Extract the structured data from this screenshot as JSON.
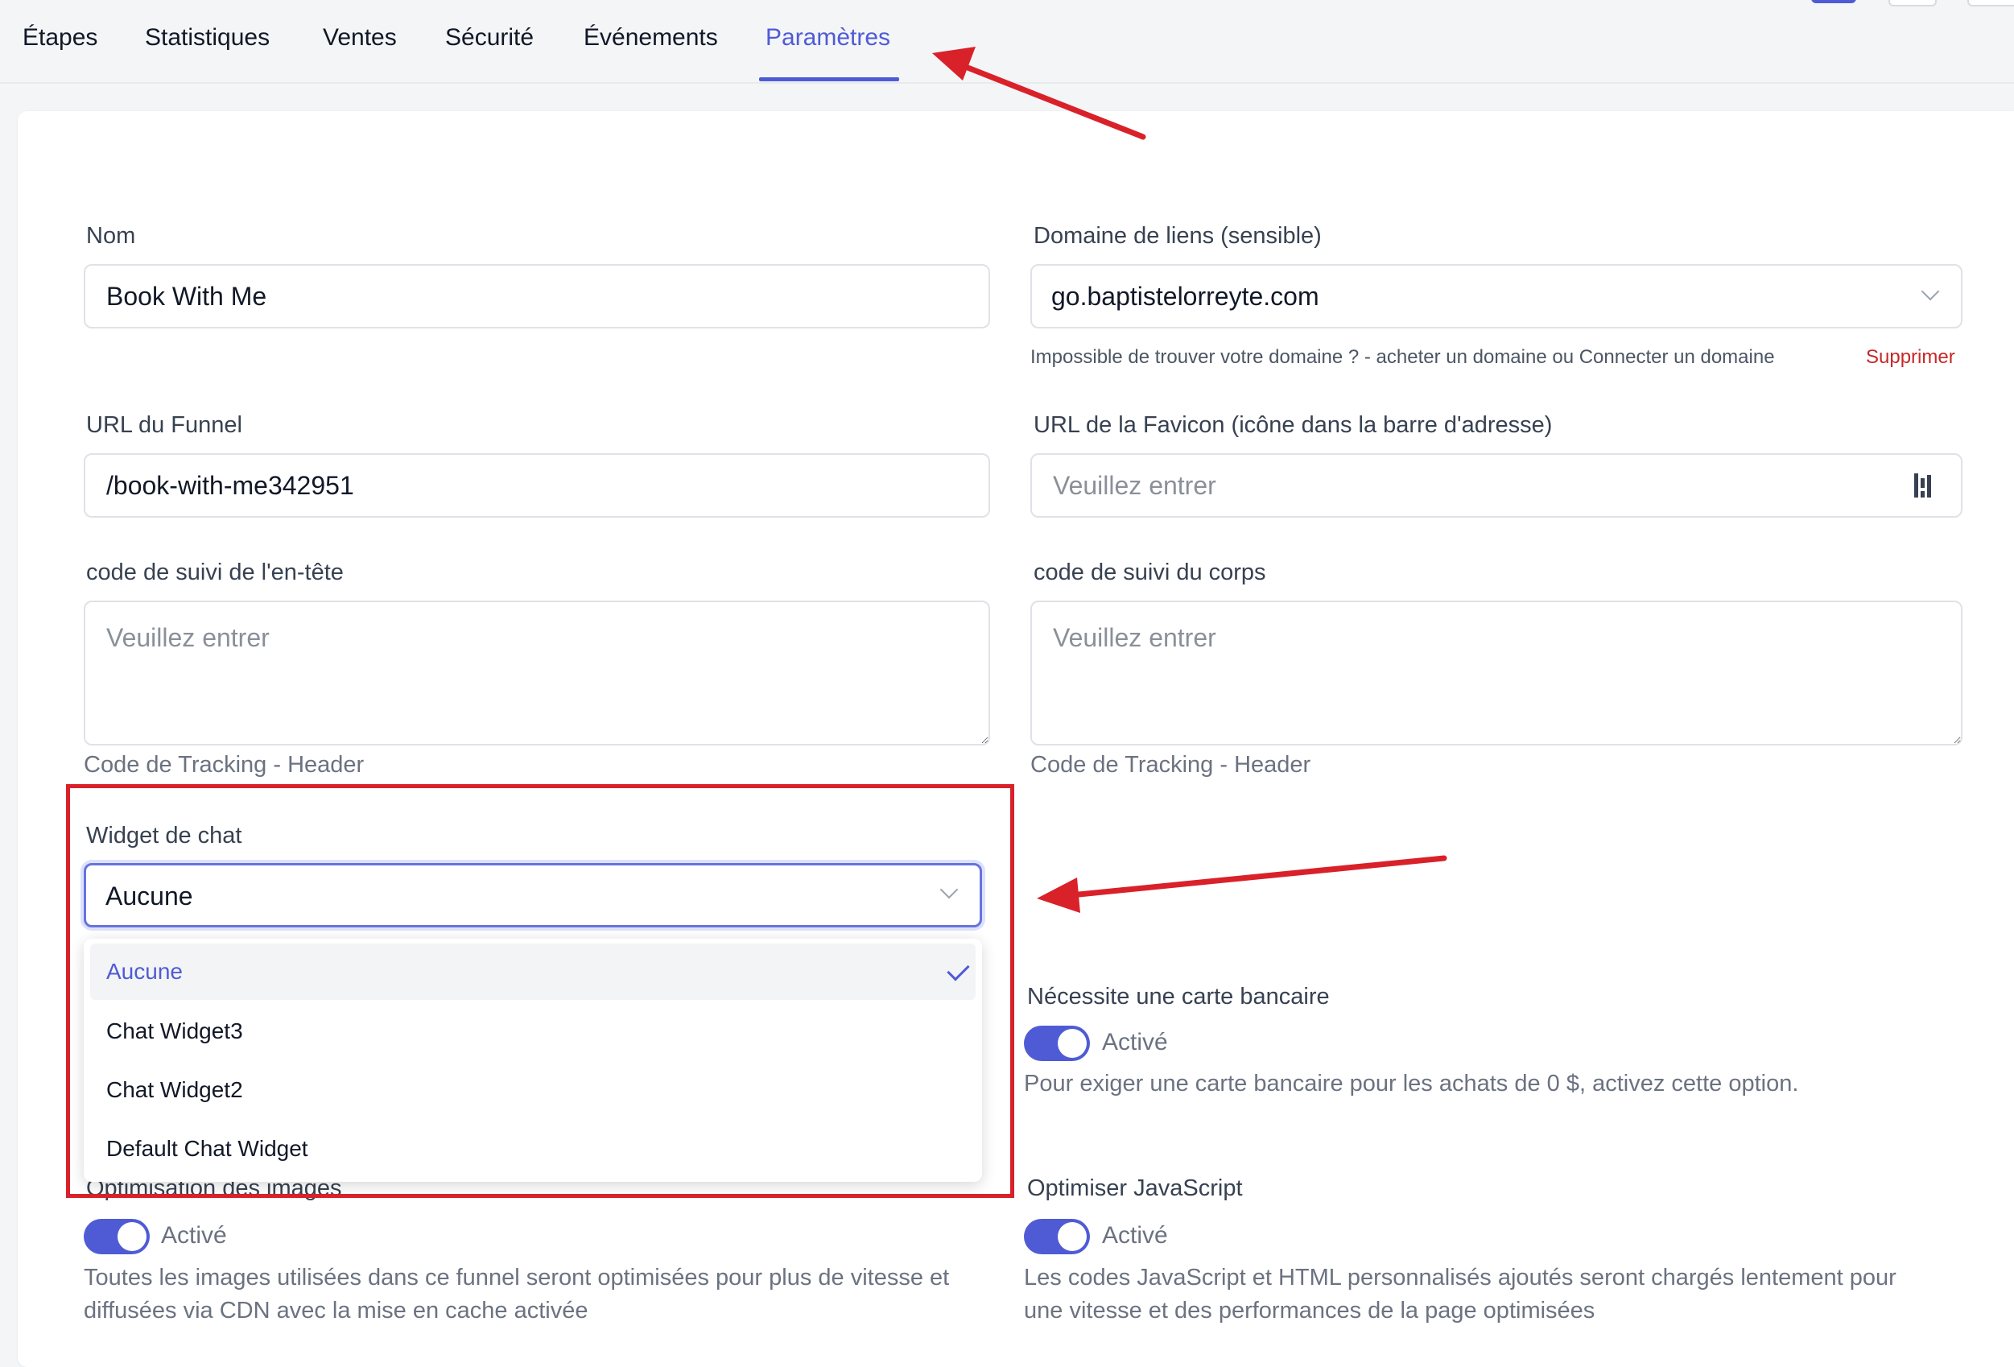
{
  "tabs": {
    "items": [
      {
        "label": "Étapes"
      },
      {
        "label": "Statistiques"
      },
      {
        "label": "Ventes"
      },
      {
        "label": "Sécurité"
      },
      {
        "label": "Événements"
      },
      {
        "label": "Paramètres"
      }
    ],
    "active_index": 5
  },
  "form": {
    "name": {
      "label": "Nom",
      "value": "Book With Me"
    },
    "domain": {
      "label": "Domaine de liens (sensible)",
      "value": "go.baptistelorreyte.com",
      "help_text": "Impossible de trouver votre domaine ? - acheter un domaine ou Connecter un domaine",
      "delete_link": "Supprimer"
    },
    "funnel_url": {
      "label": "URL du Funnel",
      "value": "/book-with-me342951"
    },
    "favicon_url": {
      "label": "URL de la Favicon (icône dans la barre d'adresse)",
      "placeholder": "Veuillez entrer"
    },
    "header_code": {
      "label": "code de suivi de l'en-tête",
      "placeholder": "Veuillez entrer",
      "hint": "Code de Tracking - Header"
    },
    "body_code": {
      "label": "code de suivi du corps",
      "placeholder": "Veuillez entrer",
      "hint": "Code de Tracking - Header"
    },
    "chat_widget": {
      "label": "Widget de chat",
      "value": "Aucune",
      "options": [
        "Aucune",
        "Chat Widget3",
        "Chat Widget2",
        "Default Chat Widget"
      ],
      "selected": "Aucune"
    },
    "credit_card": {
      "label": "Nécessite une carte bancaire",
      "toggle_text": "Activé",
      "enabled": true,
      "description": "Pour exiger une carte bancaire pour les achats de 0 $, activez cette option."
    },
    "image_opt": {
      "label": "Optimisation des images",
      "toggle_text": "Activé",
      "enabled": true,
      "description_line1": "Toutes les images utilisées dans ce funnel seront optimisées pour plus de vitesse et",
      "description_line2": "diffusées via CDN avec la mise en cache activée"
    },
    "js_opt": {
      "label": "Optimiser JavaScript",
      "toggle_text": "Activé",
      "enabled": true,
      "description_line1": "Les codes JavaScript et HTML personnalisés ajoutés seront chargés lentement pour",
      "description_line2": "une vitesse et des performances de la page optimisées"
    }
  },
  "colors": {
    "accent": "#4f5bd5",
    "annotation_red": "#d9212a",
    "danger": "#c62828"
  },
  "icons": [
    "chevron-down-icon",
    "checkmark-icon",
    "favicon-picker-icon"
  ]
}
